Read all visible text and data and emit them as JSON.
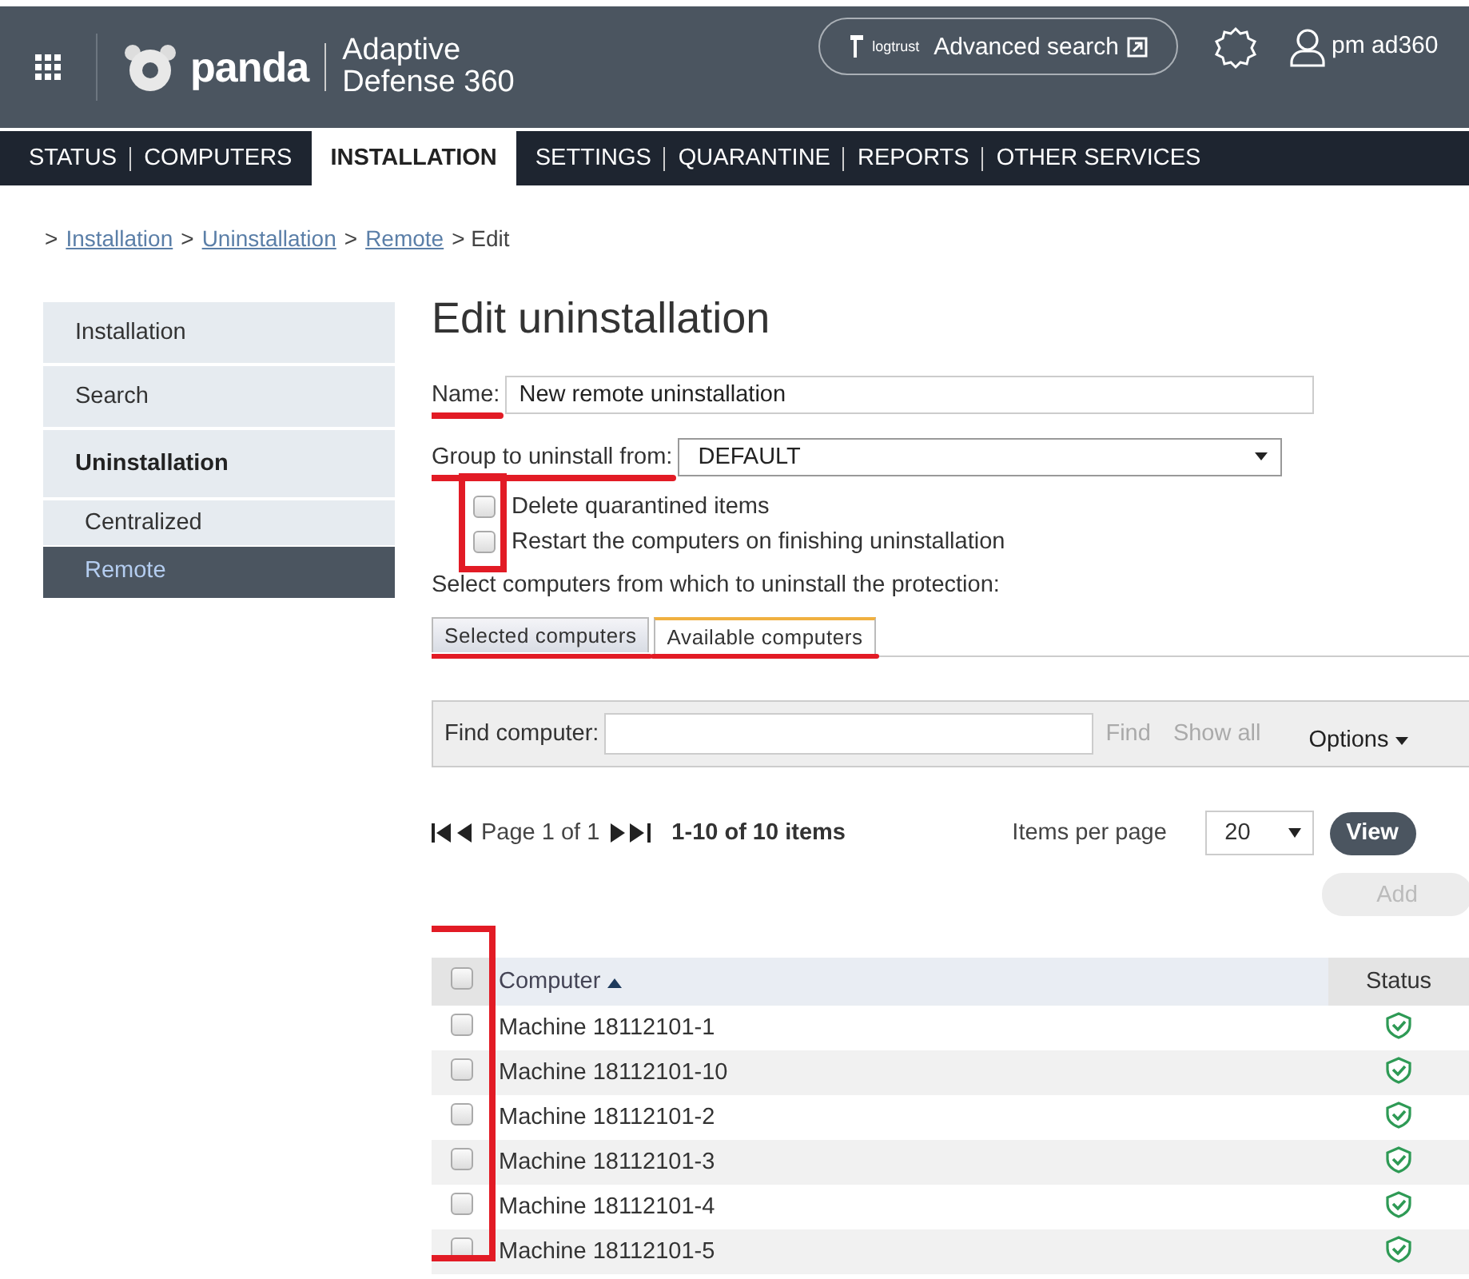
{
  "header": {
    "brand": "panda",
    "product_line1": "Adaptive",
    "product_line2": "Defense 360",
    "search_logo": "logtrust",
    "search_label": "Advanced search",
    "user": "pm ad360"
  },
  "nav": [
    {
      "label": "STATUS",
      "selected": false
    },
    {
      "label": "COMPUTERS",
      "selected": false
    },
    {
      "label": "INSTALLATION",
      "selected": true
    },
    {
      "label": "SETTINGS",
      "selected": false
    },
    {
      "label": "QUARANTINE",
      "selected": false
    },
    {
      "label": "REPORTS",
      "selected": false
    },
    {
      "label": "OTHER SERVICES",
      "selected": false
    }
  ],
  "breadcrumb": [
    {
      "label": ">",
      "link": false
    },
    {
      "label": "Installation",
      "link": true
    },
    {
      "label": ">",
      "link": false
    },
    {
      "label": "Uninstallation",
      "link": true
    },
    {
      "label": ">",
      "link": false
    },
    {
      "label": "Remote",
      "link": true
    },
    {
      "label": "> Edit",
      "link": false
    }
  ],
  "sidebar": [
    {
      "label": "Installation",
      "kind": "item",
      "selected": false
    },
    {
      "label": "Search",
      "kind": "item",
      "selected": false
    },
    {
      "label": "Uninstallation",
      "kind": "parent",
      "selected": false
    },
    {
      "label": "Centralized",
      "kind": "sub",
      "selected": false
    },
    {
      "label": "Remote",
      "kind": "sub",
      "selected": true
    }
  ],
  "form": {
    "title": "Edit uninstallation",
    "name": {
      "label": "Name:",
      "value": "New remote uninstallation",
      "annotated": true
    },
    "group": {
      "label": "Group to uninstall from:",
      "value": "DEFAULT",
      "annotated": true
    },
    "options_annotated": true,
    "options": [
      {
        "label": "Delete quarantined items",
        "checked": false
      },
      {
        "label": "Restart the computers on finishing uninstallation",
        "checked": false
      }
    ],
    "prompt": "Select computers from which to uninstall the protection:",
    "tabs": [
      {
        "label": "Selected computers",
        "selected": false,
        "annotated": true
      },
      {
        "label": "Available computers",
        "selected": true,
        "annotated": true
      }
    ],
    "find": {
      "label": "Find computer:",
      "find": "Find",
      "show_all": "Show all",
      "options": "Options"
    },
    "pager": {
      "page": "Page 1 of 1",
      "range": "1-10 of 10 items",
      "per_page_label": "Items per page",
      "per_page": "20",
      "view": "View"
    },
    "add": {
      "label": "Add",
      "disabled": true
    },
    "table": {
      "checkbox_column_annotated": true,
      "header_checked": false,
      "columns": [
        "Computer",
        "Status"
      ],
      "rows": [
        {
          "name": "Machine 18112101-1",
          "checked": false,
          "kind": "protected"
        },
        {
          "name": "Machine 18112101-10",
          "checked": false,
          "kind": "protected"
        },
        {
          "name": "Machine 18112101-2",
          "checked": false,
          "kind": "protected"
        },
        {
          "name": "Machine 18112101-3",
          "checked": false,
          "kind": "protected"
        },
        {
          "name": "Machine 18112101-4",
          "checked": false,
          "kind": "protected"
        },
        {
          "name": "Machine 18112101-5",
          "checked": false,
          "kind": "protected"
        }
      ]
    }
  }
}
